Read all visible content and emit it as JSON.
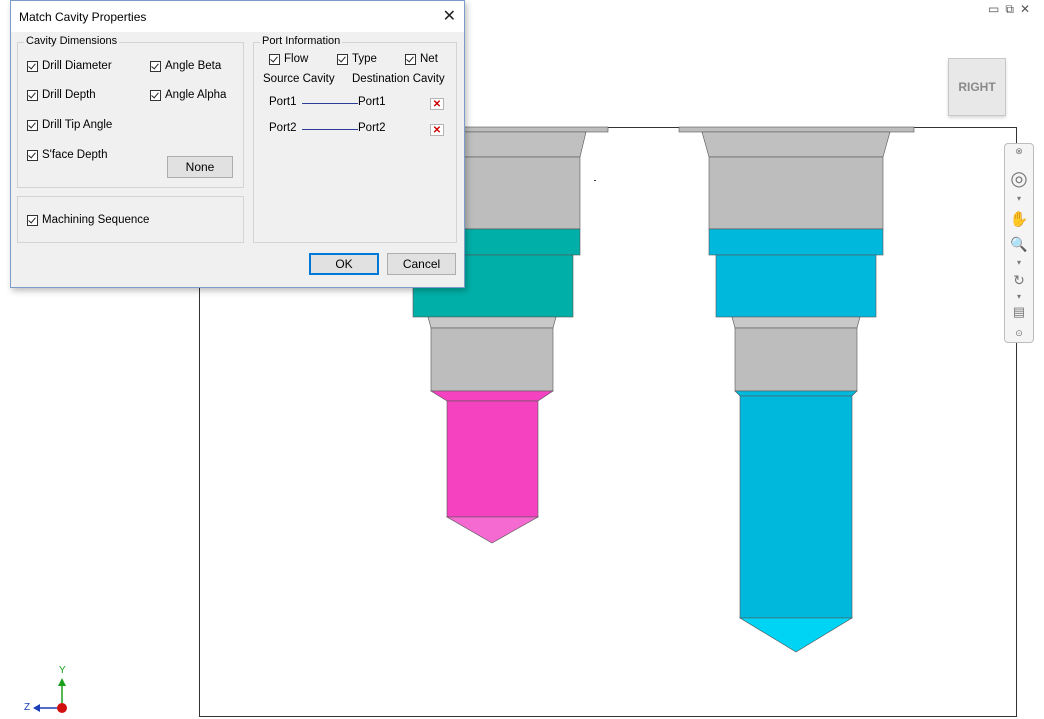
{
  "window_controls": {
    "minimize": "▭",
    "restore": "⧉",
    "close": "✕"
  },
  "viewcube": {
    "face": "RIGHT"
  },
  "dialog": {
    "title": "Match Cavity Properties",
    "close_icon": "close-icon",
    "cavity_dimensions": {
      "legend": "Cavity Dimensions",
      "checkboxes": {
        "drill_diameter": "Drill Diameter",
        "angle_beta": "Angle Beta",
        "drill_depth": "Drill Depth",
        "angle_alpha": "Angle Alpha",
        "drill_tip_angle": "Drill Tip Angle",
        "sface_depth": "S'face Depth"
      },
      "none_button": "None"
    },
    "machining_sequence": "Machining Sequence",
    "port_information": {
      "legend": "Port Information",
      "flow": "Flow",
      "type": "Type",
      "net": "Net",
      "source_header": "Source Cavity",
      "destination_header": "Destination Cavity",
      "rows": [
        {
          "source": "Port1",
          "destination": "Port1"
        },
        {
          "source": "Port2",
          "destination": "Port2"
        }
      ]
    },
    "ok_button": "OK",
    "cancel_button": "Cancel"
  },
  "triad": {
    "y_label": "Y",
    "z_label": "Z"
  },
  "colors": {
    "teal": "#00b0a8",
    "magenta": "#f542c0",
    "cyan": "#00b8dc",
    "gray": "#bebebe"
  }
}
